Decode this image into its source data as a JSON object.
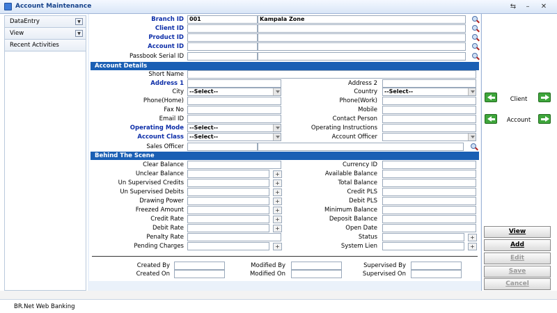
{
  "window": {
    "title": "Account Maintenance"
  },
  "sidebar": {
    "items": [
      {
        "label": "DataEntry",
        "has_dropdown": true
      },
      {
        "label": "View",
        "has_dropdown": true
      },
      {
        "label": "Recent Activities",
        "has_dropdown": false
      }
    ]
  },
  "header": {
    "branch_id_label": "Branch ID",
    "branch_id_value": "001",
    "branch_name_value": "Kampala Zone",
    "client_id_label": "Client ID",
    "product_id_label": "Product ID",
    "account_id_label": "Account ID",
    "passbook_label": "Passbook Serial ID"
  },
  "account_details": {
    "section_title": "Account Details",
    "short_name": "Short Name",
    "address1": "Address 1",
    "address2": "Address 2",
    "city": "City",
    "city_value": "--Select--",
    "country": "Country",
    "country_value": "--Select--",
    "phone_home": "Phone(Home)",
    "phone_work": "Phone(Work)",
    "fax": "Fax No",
    "mobile": "Mobile",
    "email": "Email ID",
    "contact_person": "Contact Person",
    "operating_mode": "Operating Mode",
    "operating_mode_value": "--Select--",
    "operating_instructions": "Operating Instructions",
    "account_class": "Account Class",
    "account_class_value": "--Select--",
    "account_officer": "Account Officer",
    "sales_officer": "Sales Officer"
  },
  "behind_scene": {
    "section_title": "Behind The Scene",
    "left": [
      "Clear Balance",
      "Unclear Balance",
      "Un Supervised Credits",
      "Un Supervised Debits",
      "Drawing Power",
      "Freezed Amount",
      "Credit Rate",
      "Debit Rate",
      "Penalty Rate",
      "Pending Charges"
    ],
    "right": [
      "Currency ID",
      "Available Balance",
      "Total Balance",
      "Credit PLS",
      "Debit PLS",
      "Minimum Balance",
      "Deposit Balance",
      "Open Date",
      "Status",
      "System Lien"
    ],
    "plus_label": "+"
  },
  "audit": {
    "created_by": "Created By",
    "created_on": "Created On",
    "modified_by": "Modified By",
    "modified_on": "Modified On",
    "supervised_by": "Supervised By",
    "supervised_on": "Supervised On"
  },
  "navigation": {
    "client": "Client",
    "account": "Account"
  },
  "actions": {
    "view": "View",
    "add": "Add",
    "edit": "Edit",
    "save": "Save",
    "cancel": "Cancel"
  },
  "statusbar": {
    "text": "BR.Net Web Banking"
  },
  "colors": {
    "label_blue": "#0d2ea8",
    "section_blue": "#1a5fb4",
    "arrow_green": "#3fa63c"
  }
}
